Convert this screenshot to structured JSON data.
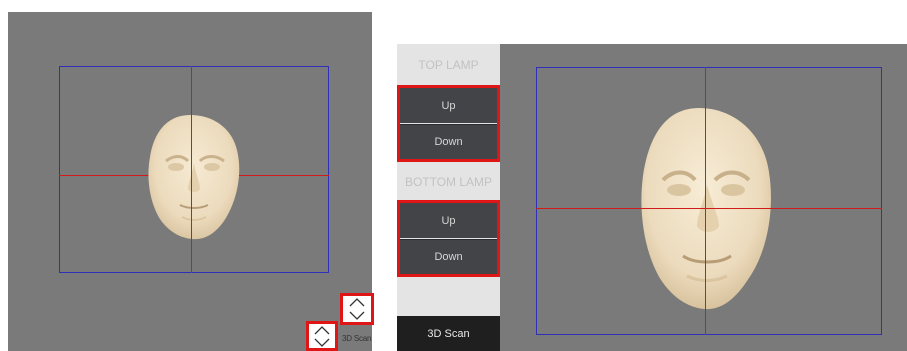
{
  "left_panel": {
    "controls": {
      "upper_stepper": {
        "up_icon": "chevron-up-icon",
        "down_icon": "chevron-down-icon"
      },
      "lower_stepper": {
        "up_icon": "chevron-up-icon",
        "down_icon": "chevron-down-icon"
      },
      "scan_label": "3D Scan"
    }
  },
  "sidebar": {
    "top_lamp_label": "TOP LAMP",
    "top_lamp_up": "Up",
    "top_lamp_down": "Down",
    "bottom_lamp_label": "BOTTOM LAMP",
    "bottom_lamp_up": "Up",
    "bottom_lamp_down": "Down",
    "scan_button": "3D Scan"
  },
  "colors": {
    "viewport_bg": "#7a7a7a",
    "frame": "#2f2fb8",
    "crosshair": "#d11a1a",
    "highlight": "#e01515",
    "lamp_button": "#434448",
    "scan_button": "#1f1f1f",
    "face": "#f1e1c6"
  }
}
